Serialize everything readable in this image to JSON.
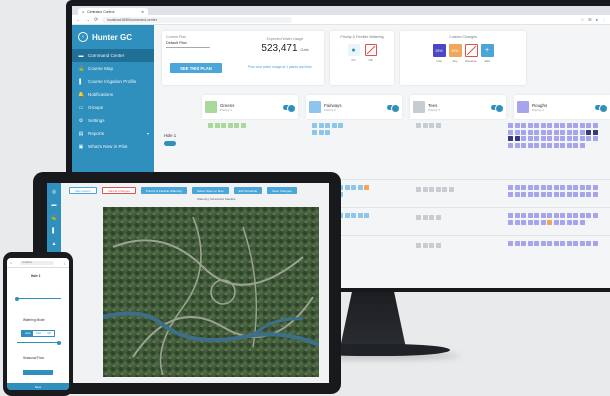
{
  "browser": {
    "tab_title": "Centralus Control",
    "url": "localhost:8080/command-center"
  },
  "brand": {
    "name": "Hunter GC"
  },
  "sidebar": {
    "items": [
      {
        "label": "Command Center",
        "icon": "home-icon"
      },
      {
        "label": "Course Map",
        "icon": "map-icon"
      },
      {
        "label": "Course Irrigation Profile",
        "icon": "profile-icon"
      },
      {
        "label": "Notifications",
        "icon": "bell-icon"
      },
      {
        "label": "Groups",
        "icon": "groups-icon"
      },
      {
        "label": "Settings",
        "icon": "gear-icon"
      },
      {
        "label": "Reports",
        "icon": "reports-icon"
      },
      {
        "label": "What's New in Pilot",
        "icon": "news-icon"
      }
    ]
  },
  "plan_card": {
    "label": "Current Plan",
    "selected": "Default Plan",
    "use_button": "SEE THIS PLAN",
    "water_label": "Expected Water Usage",
    "water_value": "523,471",
    "water_unit": "Gals",
    "note": "Plan cost water usage at 1 plants and time"
  },
  "pbp_card": {
    "title": "Priority & Flexible Watering",
    "options": [
      "On",
      "Off"
    ]
  },
  "controls_card": {
    "title": "Custom Changes",
    "options": [
      {
        "value": "25%",
        "label": "Low"
      },
      {
        "value": "50%",
        "label": "Dry"
      },
      {
        "value": "",
        "label": "Reverse"
      },
      {
        "value": "+",
        "label": "Add"
      }
    ]
  },
  "columns": [
    {
      "name": "Greens",
      "sub": "Priority 1"
    },
    {
      "name": "Fairways",
      "sub": "Priority 2"
    },
    {
      "name": "Tees",
      "sub": "Priority 3"
    },
    {
      "name": "Roughs",
      "sub": "Priority 4"
    }
  ],
  "hole": {
    "label": "Hole 1"
  },
  "tablet": {
    "chips": [
      "Map Layers",
      "Cancel Changes",
      "Priority & Flexible Watering",
      "Select Sites on Map",
      "Edit Schedule",
      "Save Changes"
    ],
    "subline": "Watering Scheduled    Satellite"
  },
  "phone": {
    "url": "localhost",
    "title": "Hole 1",
    "section1": "Watering Mode",
    "segments": [
      "Auto",
      "Flex",
      "Off"
    ],
    "section2": "Seasonal Flow",
    "bottom": "Save"
  },
  "colors": {
    "sidebar": "#2f8fbd",
    "greens": "#a9d89b",
    "fairways": "#8dc6ea",
    "tees": "#c7ccd2",
    "roughs": "#a7a4ee"
  }
}
